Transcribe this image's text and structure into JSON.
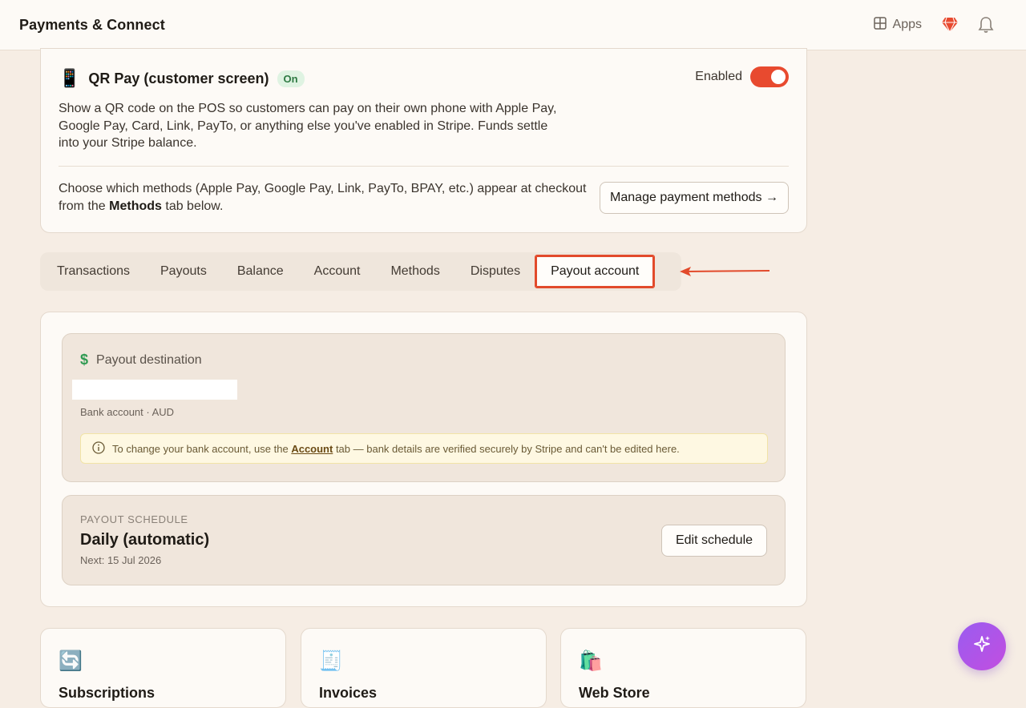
{
  "header": {
    "title": "Payments & Connect",
    "apps_label": "Apps"
  },
  "qr": {
    "icon": "phone-icon",
    "title": "QR Pay (customer screen)",
    "badge": "On",
    "enabled_label": "Enabled",
    "enabled": true,
    "description": "Show a QR code on the POS so customers can pay on their own phone with Apple Pay, Google Pay, Card, Link, PayTo, or anything else you've enabled in Stripe. Funds settle into your Stripe balance.",
    "methods_prefix": "Choose which methods (Apple Pay, Google Pay, Link, PayTo, BPAY, etc.) appear at checkout from the ",
    "methods_bold": "Methods",
    "methods_suffix": " tab below.",
    "manage_button": "Manage payment methods →"
  },
  "tabs": [
    {
      "label": "Transactions"
    },
    {
      "label": "Payouts"
    },
    {
      "label": "Balance"
    },
    {
      "label": "Account"
    },
    {
      "label": "Methods"
    },
    {
      "label": "Disputes"
    },
    {
      "label": "Payout account",
      "active": true
    }
  ],
  "payout": {
    "destination_title": "Payout destination",
    "bank_sub": "Bank account · AUD",
    "notice_prefix": "To change your bank account, use the ",
    "notice_link": "Account",
    "notice_suffix": " tab — bank details are verified securely by Stripe and can't be edited here.",
    "schedule_label": "PAYOUT SCHEDULE",
    "schedule_value": "Daily (automatic)",
    "schedule_next": "Next: 15 Jul 2026",
    "edit_button": "Edit schedule"
  },
  "mini_cards": [
    {
      "icon": "refresh-icon",
      "title": "Subscriptions"
    },
    {
      "icon": "receipt-icon",
      "title": "Invoices"
    },
    {
      "icon": "shopping-bags-icon",
      "title": "Web Store"
    }
  ],
  "colors": {
    "accent": "#e84a2f",
    "background": "#f6ede4",
    "card": "#fdfaf6",
    "fab_start": "#9a5cf0",
    "fab_end": "#c24ee0"
  }
}
